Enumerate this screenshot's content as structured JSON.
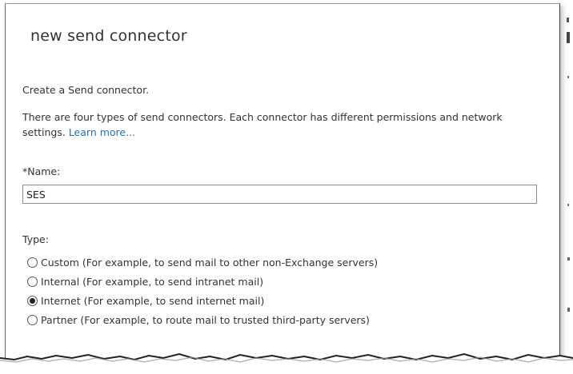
{
  "dialog": {
    "title": "new send connector",
    "intro": "Create a Send connector.",
    "description": "There are four types of send connectors. Each connector has different permissions and network settings.",
    "learn_more": "Learn more..."
  },
  "name_field": {
    "label": "*Name:",
    "value": "SES"
  },
  "type_field": {
    "label": "Type:",
    "selected": "Internet",
    "options": [
      {
        "label": "Custom (For example, to send mail to other non-Exchange servers)",
        "checked": false
      },
      {
        "label": "Internal (For example, to send intranet mail)",
        "checked": false
      },
      {
        "label": "Internet (For example, to send internet mail)",
        "checked": true
      },
      {
        "label": "Partner (For example, to route mail to trusted third-party servers)",
        "checked": false
      }
    ]
  },
  "colors": {
    "text": "#333333",
    "link": "#1e6fba",
    "border": "#8c8c8c"
  }
}
